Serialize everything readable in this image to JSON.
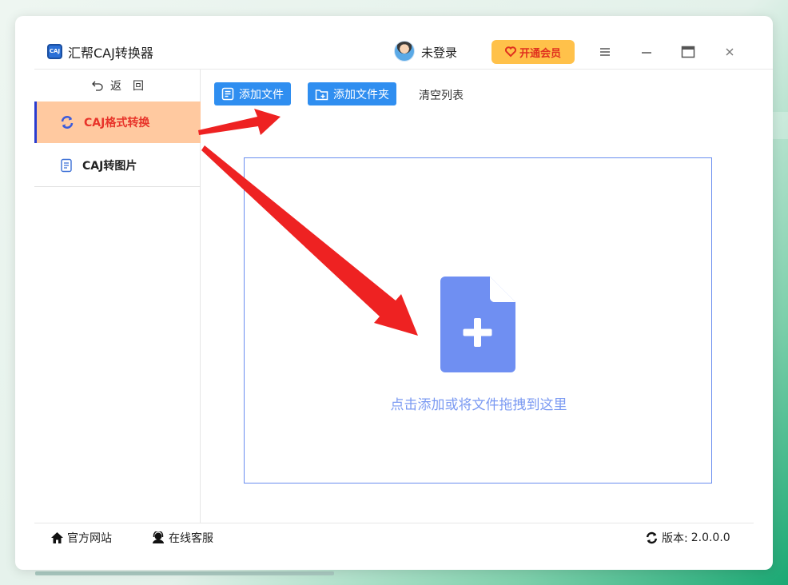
{
  "app": {
    "title": "汇帮CAJ转换器",
    "logo_text": "CAJ"
  },
  "header": {
    "user_label": "未登录",
    "vip_button": "开通会员"
  },
  "sidebar": {
    "back_label": "返　回",
    "items": [
      {
        "label": "CAJ格式转换",
        "icon": "refresh-icon",
        "active": true
      },
      {
        "label": "CAJ转图片",
        "icon": "document-icon",
        "active": false
      }
    ]
  },
  "toolbar": {
    "add_file": "添加文件",
    "add_folder": "添加文件夹",
    "clear_list": "清空列表"
  },
  "dropzone": {
    "hint": "点击添加或将文件拖拽到这里"
  },
  "footer": {
    "official_site": "官方网站",
    "online_service": "在线客服",
    "version_label": "版本:",
    "version_value": "2.0.0.0"
  },
  "colors": {
    "accent_blue": "#2f8ef0",
    "active_bg": "#ffc9a0",
    "active_text": "#e8342a",
    "vip_bg": "#ffc14a",
    "drop_icon": "#6f8ff2",
    "arrow_red": "#ee2222"
  }
}
